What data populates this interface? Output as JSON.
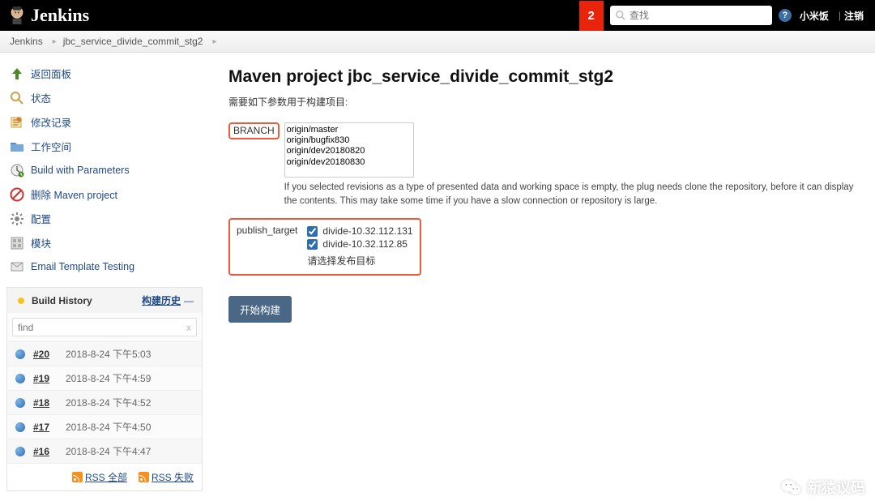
{
  "header": {
    "brand": "Jenkins",
    "notif_count": "2",
    "search_placeholder": "查找",
    "user": "小米饭",
    "logout": "注销"
  },
  "breadcrumb": {
    "items": [
      "Jenkins",
      "jbc_service_divide_commit_stg2"
    ]
  },
  "side": {
    "tasks": [
      {
        "icon": "up-arrow-icon",
        "label": "返回面板"
      },
      {
        "icon": "magnifier-icon",
        "label": "状态"
      },
      {
        "icon": "edit-icon",
        "label": "修改记录"
      },
      {
        "icon": "folder-icon",
        "label": "工作空间"
      },
      {
        "icon": "clock-icon",
        "label": "Build with Parameters"
      },
      {
        "icon": "delete-icon",
        "label": "删除 Maven project"
      },
      {
        "icon": "gear-icon",
        "label": "配置"
      },
      {
        "icon": "module-icon",
        "label": "模块"
      },
      {
        "icon": "mail-icon",
        "label": "Email Template Testing"
      }
    ],
    "history": {
      "title": "Build History",
      "trend": "构建历史",
      "filter_placeholder": "find",
      "clear": "x",
      "builds": [
        {
          "num": "#20",
          "date": "2018-8-24 下午5:03"
        },
        {
          "num": "#19",
          "date": "2018-8-24 下午4:59"
        },
        {
          "num": "#18",
          "date": "2018-8-24 下午4:52"
        },
        {
          "num": "#17",
          "date": "2018-8-24 下午4:50"
        },
        {
          "num": "#16",
          "date": "2018-8-24 下午4:47"
        }
      ],
      "rss_all": "RSS 全部",
      "rss_fail": "RSS 失败"
    }
  },
  "main": {
    "title": "Maven project jbc_service_divide_commit_stg2",
    "subtitle": "需要如下参数用于构建项目:",
    "params": {
      "branch": {
        "label": "BRANCH",
        "options": [
          "origin/master",
          "origin/bugfix830",
          "origin/dev20180820",
          "origin/dev20180830"
        ],
        "desc": "If you selected revisions as a type of presented data and working space is empty, the plug needs clone the repository, before it can display the contents. This may take some time if you have a slow connection or repository is large."
      },
      "publish_target": {
        "label": "publish_target",
        "options": [
          {
            "label": "divide-10.32.112.131",
            "checked": true
          },
          {
            "label": "divide-10.32.112.85",
            "checked": true
          }
        ],
        "hint": "请选择发布目标"
      }
    },
    "build_button": "开始构建"
  },
  "watermark": "新猿议码"
}
